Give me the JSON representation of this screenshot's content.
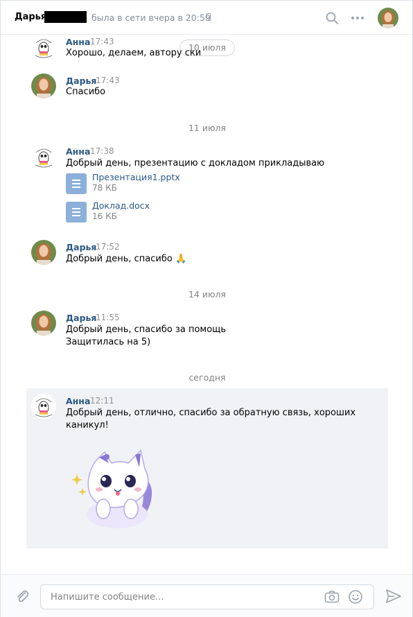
{
  "header": {
    "name": "Дарья",
    "status": "была в сети вчера в 20:59"
  },
  "floating_date": "10 июля",
  "messages": [
    {
      "author": "Анна",
      "time": "17:43",
      "lines": [
        "Хорошо, делаем, автору ск..."
      ],
      "visible_lines": [
        "Хорошо, делаем, автору ски"
      ]
    },
    {
      "author": "Дарья",
      "time": "17:43",
      "lines": [
        "Спасибо"
      ]
    },
    {
      "author": "Анна",
      "time": "17:38",
      "lines": [
        "Добрый день, презентацию с докладом прикладываю"
      ]
    },
    {
      "author": "Дарья",
      "time": "17:52",
      "lines": [
        "Добрый день, спасибо 🙏"
      ]
    },
    {
      "author": "Дарья",
      "time": "11:55",
      "lines": [
        "Добрый день, спасибо за помощь",
        "Защитилась на 5)"
      ]
    },
    {
      "author": "Анна",
      "time": "12:11",
      "lines": [
        "Добрый день, отлично, спасибо за обратную связь, хороших",
        "каникул!"
      ]
    }
  ],
  "dates": [
    "11 июля",
    "14 июля",
    "сегодня"
  ],
  "files": [
    {
      "name": "Презентация1.pptx",
      "size": "78 КБ"
    },
    {
      "name": "Доклад.docx",
      "size": "16 КБ"
    }
  ],
  "composer": {
    "placeholder": "Напишите сообщение..."
  },
  "colors": {
    "link": "#2a5885",
    "highlight": "#f0f2f5",
    "file_icon": "#8cb0d9"
  }
}
